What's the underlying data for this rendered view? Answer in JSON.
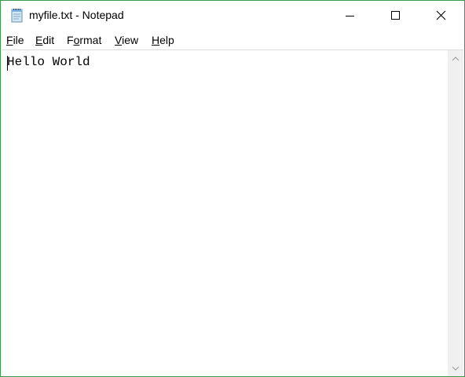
{
  "window": {
    "title": "myfile.txt - Notepad",
    "icon": "notepad-icon",
    "controls": [
      "minimize-icon",
      "maximize-icon",
      "close-icon"
    ]
  },
  "menu": {
    "file": {
      "accel": "F",
      "rest": "ile"
    },
    "edit": {
      "accel": "E",
      "rest": "dit"
    },
    "format": {
      "accel": "o",
      "pre": "F",
      "rest": "rmat"
    },
    "view": {
      "accel": "V",
      "rest": "iew"
    },
    "help": {
      "accel": "H",
      "rest": "elp"
    }
  },
  "editor": {
    "content": "Hello World"
  },
  "colors": {
    "window_border": "#3c9a4c",
    "scrollbar_track": "#f0f0f0",
    "scroll_arrow": "#a0a0a0"
  }
}
